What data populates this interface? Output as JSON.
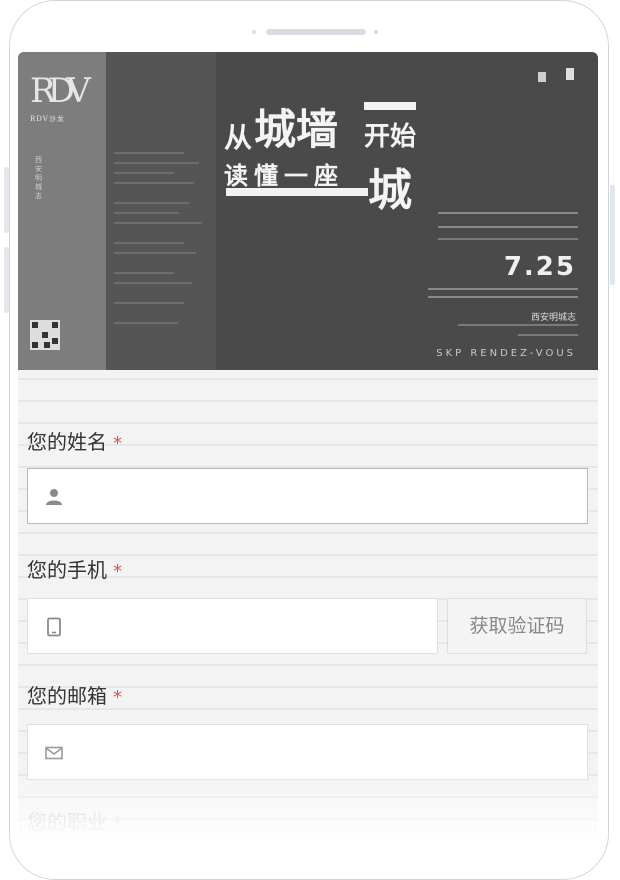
{
  "poster": {
    "logo_mark": "RDV",
    "logo_sub": "RDV沙龙",
    "vertical_text": "西安明城志",
    "title_line1_a": "从",
    "title_line1_b": "城墙",
    "title_line1_c": "开始",
    "title_line2_a": "读懂一座",
    "title_line2_b": "城",
    "date": "7.25",
    "event_name": "西安明城志",
    "tagline": "SKP RENDEZ-VOUS"
  },
  "form": {
    "name_label": "您的姓名",
    "phone_label": "您的手机",
    "email_label": "您的邮箱",
    "job_label": "您的职业",
    "required_mark": "*",
    "get_code_button": "获取验证码"
  },
  "icons": {
    "name": "user-icon",
    "phone": "phone-icon",
    "email": "mail-icon"
  },
  "colors": {
    "required": "#d9534f",
    "poster_bg": "#4a4a4a",
    "input_border": "#b8b8b8"
  }
}
